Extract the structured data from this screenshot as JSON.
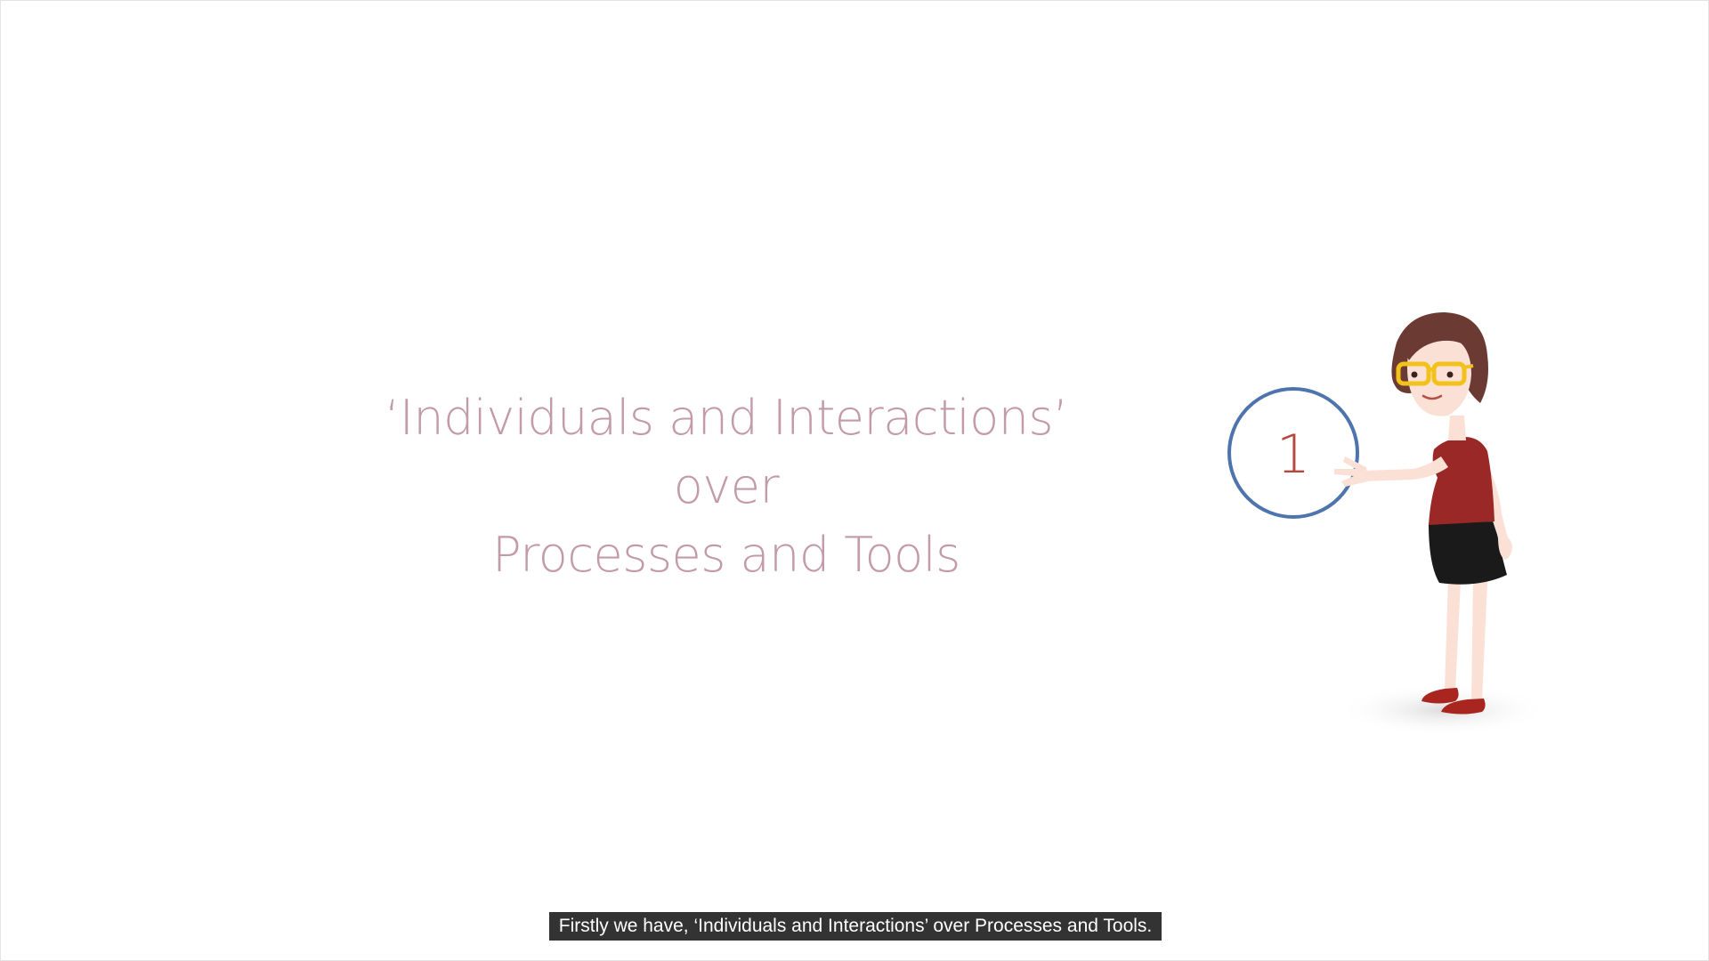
{
  "slide": {
    "lines": [
      "‘Individuals and Interactions’",
      "over",
      "Processes and Tools"
    ],
    "text_color": "#c39aaa"
  },
  "illustration": {
    "number": "1",
    "circle_color": "#4e74ad",
    "number_color": "#b5473c",
    "dress_color": "#9a2826",
    "skirt_color": "#1a1a1a",
    "hair_color": "#6b3a32",
    "glasses_color": "#f2c21b",
    "shoe_color": "#a82520",
    "skin_color": "#fbe0d6"
  },
  "subtitle": {
    "text": "Firstly we have, ‘Individuals and Interactions’ over Processes and Tools."
  }
}
